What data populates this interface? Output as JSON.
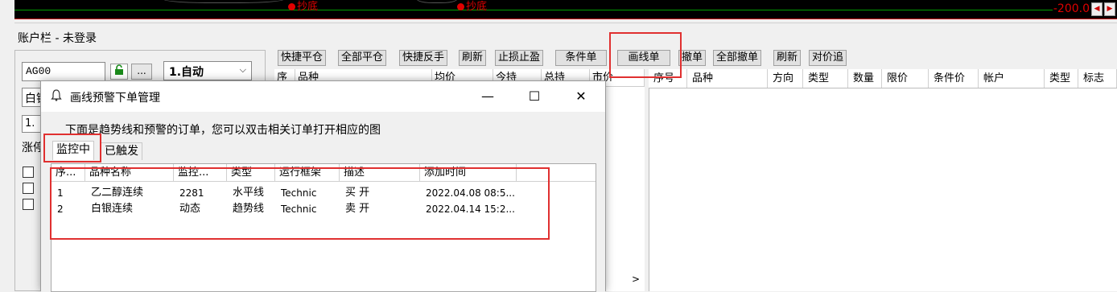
{
  "chart": {
    "bottom_label": "抄底",
    "price_label": "-200.0",
    "scroll_left": "◀",
    "scroll_right": "▶"
  },
  "account_bar": {
    "label": "账户栏 - 未登录"
  },
  "left_panel": {
    "code_value": "AG00",
    "lock_icon": "lock-icon",
    "more_button": "...",
    "mode_select": "1.自动",
    "mode_arrow": "⌵",
    "trunc_row1": "白银",
    "trunc_row2": "1.",
    "trunc_row3": "涨停"
  },
  "toolbar": {
    "left_buttons": [
      "快捷平仓",
      "全部平仓",
      "快捷反手",
      "刷新",
      "止损止盈",
      "条件单",
      "画线单"
    ],
    "right_buttons": [
      "撤单",
      "全部撤单",
      "刷新",
      "对价追"
    ]
  },
  "positions_table": {
    "columns": [
      "序",
      "品种",
      "均价",
      "今持",
      "总持",
      "市价"
    ]
  },
  "orders_table": {
    "columns": [
      "序号",
      "品种",
      "方向",
      "类型",
      "数量",
      "限价",
      "条件价",
      "帐户",
      "类型",
      "标志"
    ]
  },
  "scroll_arrow": ">",
  "dialog": {
    "title": "画线预警下单管理",
    "minimize": "—",
    "maximize": "☐",
    "close": "✕",
    "hint": "下面是趋势线和预警的订单，您可以双击相关订单打开相应的图",
    "tabs": [
      "监控中",
      "已触发"
    ],
    "columns": [
      "序...",
      "品种名称",
      "监控...",
      "类型",
      "运行框架",
      "描述",
      "添加时间"
    ],
    "rows": [
      [
        "1",
        "乙二醇连续",
        "2281",
        "水平线",
        "Technic",
        "买 开",
        "2022.04.08 08:5..."
      ],
      [
        "2",
        "白银连续",
        "动态",
        "趋势线",
        "Technic",
        "卖 开",
        "2022.04.14 15:2..."
      ]
    ]
  },
  "colors": {
    "highlight": "#e03030",
    "chart_bg": "#000000",
    "price_red": "#e00000",
    "lock_green": "#1a8a1a"
  }
}
